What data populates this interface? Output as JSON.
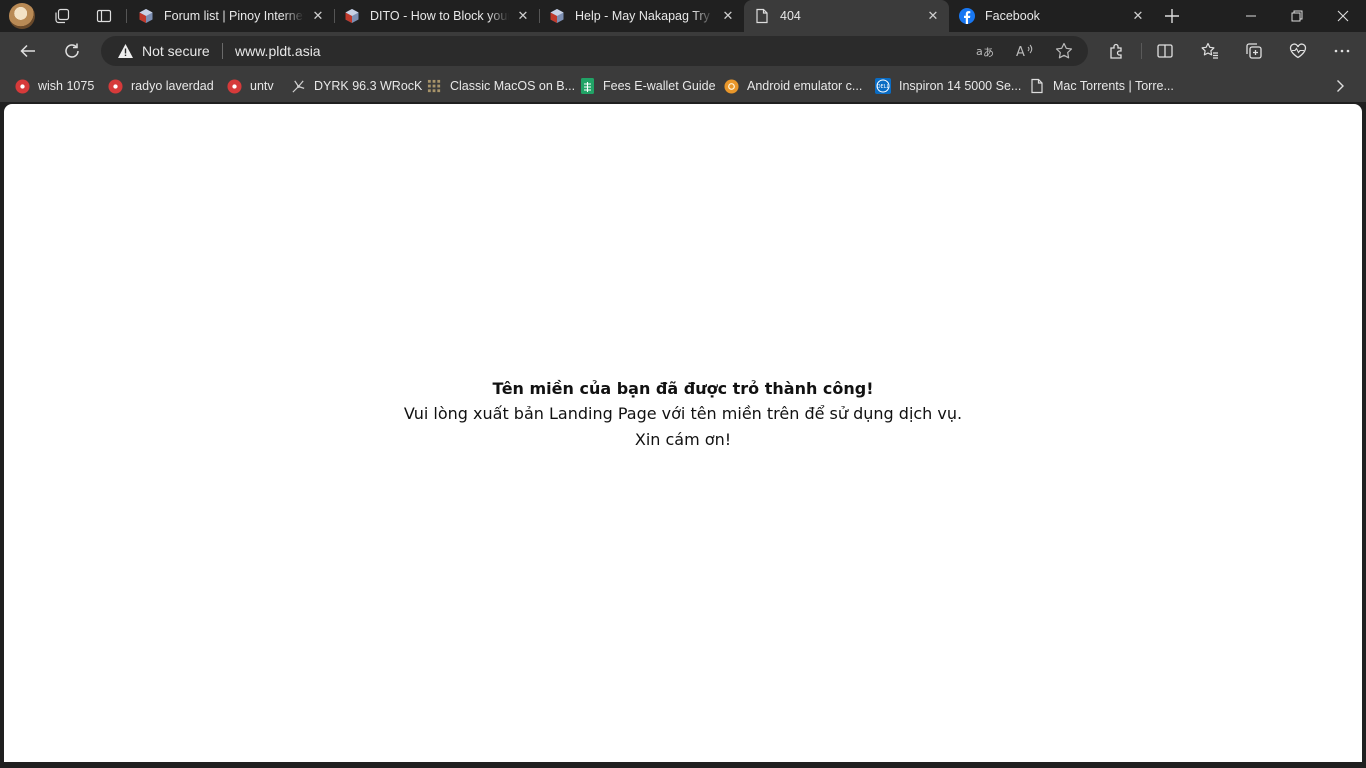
{
  "tabs": [
    {
      "title": "Forum list | Pinoy Internet and Technology Forums",
      "favicon": "pinoy-forum-icon",
      "active": false
    },
    {
      "title": "DITO - How to Block your Phone",
      "favicon": "pinoy-forum-icon",
      "active": false
    },
    {
      "title": "Help - May Nakapag Try na?",
      "favicon": "pinoy-forum-icon",
      "active": false
    },
    {
      "title": "404",
      "favicon": "page-icon",
      "active": true
    },
    {
      "title": "Facebook",
      "favicon": "facebook-icon",
      "active": false
    }
  ],
  "address_bar": {
    "security_label": "Not secure",
    "url": "www.pldt.asia"
  },
  "bookmarks": [
    {
      "label": "wish 1075",
      "icon": "red-radio-icon"
    },
    {
      "label": "radyo laverdad",
      "icon": "red-radio-icon"
    },
    {
      "label": "untv",
      "icon": "red-radio-icon"
    },
    {
      "label": "DYRK 96.3 WRocK",
      "icon": "signal-icon"
    },
    {
      "label": "Classic MacOS on B...",
      "icon": "grid-icon"
    },
    {
      "label": "Fees E-wallet Guide",
      "icon": "sheets-icon"
    },
    {
      "label": "Android emulator c...",
      "icon": "orange-circle-icon"
    },
    {
      "label": "Inspiron 14 5000 Se...",
      "icon": "dell-icon"
    },
    {
      "label": "Mac Torrents | Torre...",
      "icon": "page-icon"
    }
  ],
  "page": {
    "title": "Tên miền của bạn đã được trỏ thành công!",
    "line1": "Vui lòng xuất bản Landing Page với tên miền trên để sử dụng dịch vụ.",
    "line2": "Xin cám ơn!"
  },
  "colors": {
    "chrome_dark": "#202020",
    "toolbar": "#3b3b3b",
    "omnibox": "#2b2b2b",
    "page_bg": "#ffffff",
    "facebook_blue": "#1877f2"
  }
}
